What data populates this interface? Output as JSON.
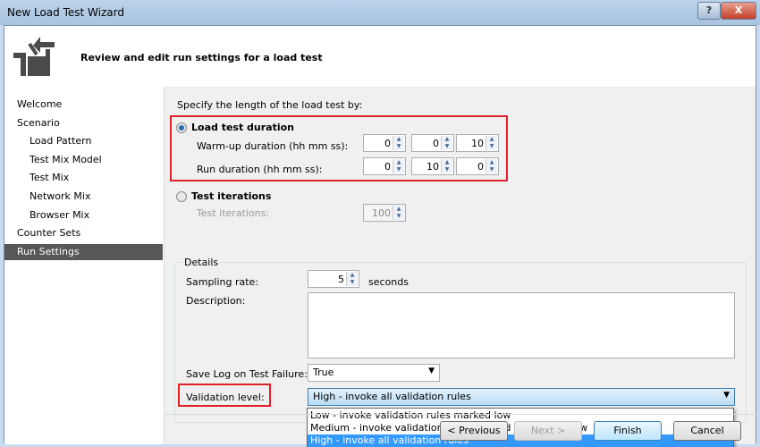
{
  "window": {
    "title": "New Load Test Wizard",
    "help": "?",
    "close": "X"
  },
  "header": {
    "text": "Review and edit run settings for a load test"
  },
  "sidebar": {
    "items": [
      {
        "label": "Welcome",
        "sub": false
      },
      {
        "label": "Scenario",
        "sub": false
      },
      {
        "label": "Load Pattern",
        "sub": true
      },
      {
        "label": "Test Mix Model",
        "sub": true
      },
      {
        "label": "Test Mix",
        "sub": true
      },
      {
        "label": "Network Mix",
        "sub": true
      },
      {
        "label": "Browser Mix",
        "sub": true
      },
      {
        "label": "Counter Sets",
        "sub": false
      },
      {
        "label": "Run Settings",
        "sub": false,
        "selected": true
      }
    ]
  },
  "main": {
    "specify": "Specify the length of the load test by:",
    "duration_radio": "Load test duration",
    "warmup_label": "Warm-up duration (hh mm ss):",
    "warmup": [
      "0",
      "0",
      "10"
    ],
    "run_label": "Run duration (hh mm ss):",
    "run": [
      "0",
      "10",
      "0"
    ],
    "iter_radio": "Test iterations",
    "iter_label": "Test iterations:",
    "iter_value": "100",
    "details": {
      "title": "Details",
      "sampling_label": "Sampling rate:",
      "sampling_value": "5",
      "sampling_unit": "seconds",
      "description_label": "Description:",
      "description_value": "",
      "savelog_label": "Save Log on Test Failure:",
      "savelog_value": "True",
      "validation_label": "Validation level:",
      "validation_value": "High - invoke all validation rules",
      "validation_options": [
        "Low - invoke validation rules marked low",
        "Medium - invoke validation rules marked medium or low",
        "High - invoke all validation rules"
      ]
    }
  },
  "buttons": {
    "previous": "< Previous",
    "next": "Next >",
    "finish": "Finish",
    "cancel": "Cancel"
  }
}
